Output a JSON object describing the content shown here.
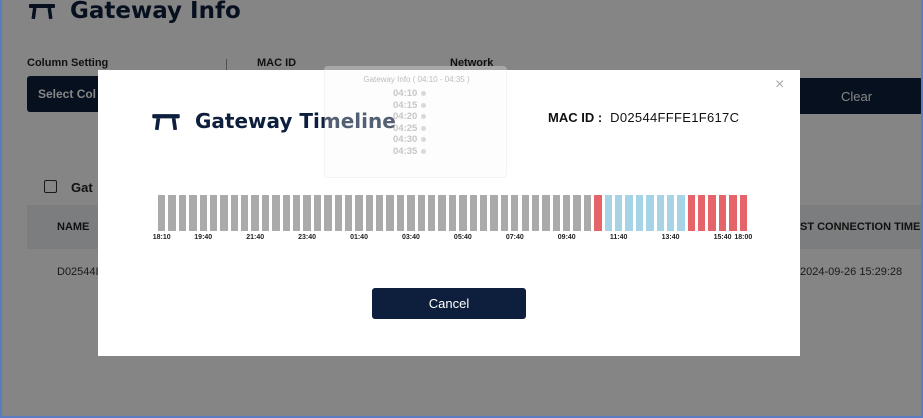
{
  "page": {
    "title": "Gateway Info",
    "filters": {
      "column_setting": "Column Setting",
      "mac_id": "MAC ID",
      "network": "Network"
    },
    "select_button": "Select Col",
    "clear_button": "Clear",
    "gateway_label": "Gat",
    "table": {
      "col_name": "NAME",
      "col_last_connection": "ST CONNECTION TIME",
      "row_name": "D02544I",
      "row_last_connection": "2024-09-26 15:29:28"
    }
  },
  "modal": {
    "title": "Gateway Timeline",
    "mac_label": "MAC ID :",
    "mac_value": "D02544FFFE1F617C",
    "close_symbol": "×",
    "cancel_button": "Cancel",
    "tooltip": {
      "title": "Gateway Info ( 04:10 - 04:35 )",
      "times": [
        "04:10",
        "04:15",
        "04:20",
        "04:25",
        "04:30",
        "04:35"
      ]
    },
    "timeline": {
      "colors": {
        "offline": "#aaaaaa",
        "online": "#a7d3e6",
        "error": "#e5646a"
      },
      "segments": [
        "offline",
        "offline",
        "offline",
        "offline",
        "offline",
        "offline",
        "offline",
        "offline",
        "offline",
        "offline",
        "offline",
        "offline",
        "offline",
        "offline",
        "offline",
        "offline",
        "offline",
        "offline",
        "offline",
        "offline",
        "offline",
        "offline",
        "offline",
        "offline",
        "offline",
        "offline",
        "offline",
        "offline",
        "offline",
        "offline",
        "offline",
        "offline",
        "offline",
        "offline",
        "offline",
        "offline",
        "offline",
        "offline",
        "offline",
        "offline",
        "offline",
        "offline",
        "error",
        "online",
        "online",
        "online",
        "online",
        "online",
        "online",
        "online",
        "online",
        "error",
        "error",
        "error",
        "error",
        "error",
        "error"
      ],
      "ticks": [
        "18:10",
        "19:40",
        "21:40",
        "23:40",
        "01:40",
        "03:40",
        "05:40",
        "07:40",
        "09:40",
        "11:40",
        "13:40",
        "15:40",
        "18:00"
      ]
    }
  },
  "icons": {
    "gateway": "gateway-icon",
    "close": "close-icon"
  }
}
